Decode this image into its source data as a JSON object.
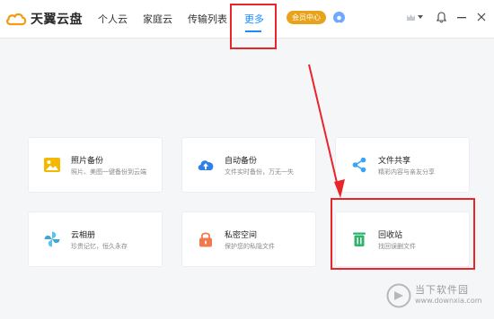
{
  "app": {
    "logo_text": "天翼云盘"
  },
  "nav": {
    "items": [
      {
        "label": "个人云"
      },
      {
        "label": "家庭云"
      },
      {
        "label": "传输列表"
      },
      {
        "label": "更多",
        "active": true
      }
    ]
  },
  "header": {
    "vip_label": "会员中心",
    "icons": [
      "crown-icon",
      "chevron-down-icon",
      "bell-icon",
      "minimize-icon",
      "close-icon",
      "avatar"
    ]
  },
  "cards": [
    {
      "title": "照片备份",
      "desc": "照片、美图一键备份到云端",
      "icon": "photo-icon",
      "color": "#f5b800"
    },
    {
      "title": "自动备份",
      "desc": "文件实时备份，万无一失",
      "icon": "cloud-upload-icon",
      "color": "#2f80ed"
    },
    {
      "title": "文件共享",
      "desc": "精彩内容与亲友分享",
      "icon": "share-icon",
      "color": "#38a4f5"
    },
    {
      "title": "云相册",
      "desc": "珍贵记忆，恒久永存",
      "icon": "pinwheel-icon",
      "color": "#5cc2e8"
    },
    {
      "title": "私密空间",
      "desc": "保护您的私隐文件",
      "icon": "lock-icon",
      "color": "#f07a4e"
    },
    {
      "title": "回收站",
      "desc": "找回误删文件",
      "icon": "trash-icon",
      "color": "#2fb36e"
    }
  ],
  "annotation_color": "#e8252b",
  "watermark": {
    "title": "当下软件园",
    "url": "www.downxia.com"
  }
}
